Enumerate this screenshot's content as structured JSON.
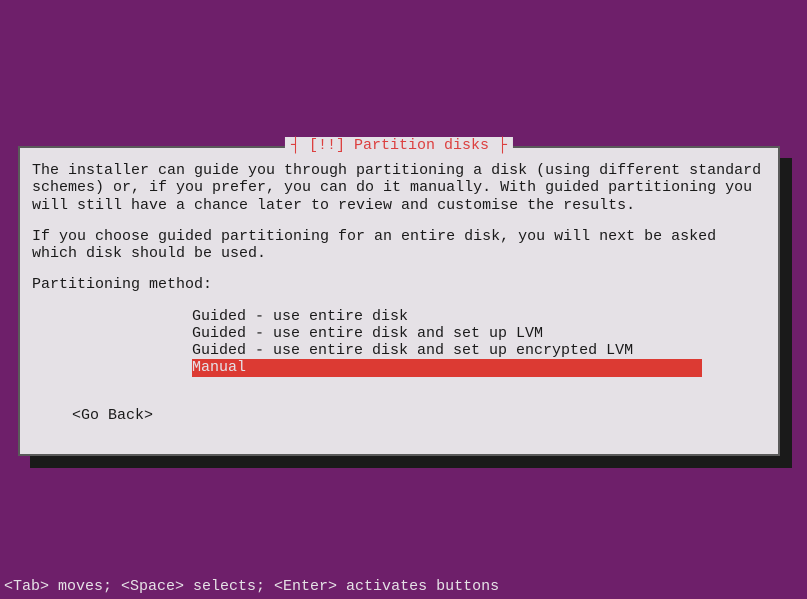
{
  "dialog": {
    "title_decoration_left": "┤ ",
    "title_priority": "[!!]",
    "title_text": " Partition disks",
    "title_decoration_right": " ├",
    "paragraph1": "The installer can guide you through partitioning a disk (using different standard schemes) or, if you prefer, you can do it manually. With guided partitioning you will still have a chance later to review and customise the results.",
    "paragraph2": "If you choose guided partitioning for an entire disk, you will next be asked which disk should be used.",
    "prompt": "Partitioning method:",
    "options": [
      "Guided - use entire disk",
      "Guided - use entire disk and set up LVM",
      "Guided - use entire disk and set up encrypted LVM",
      "Manual"
    ],
    "selected_index": 3,
    "go_back": "<Go Back>"
  },
  "footer_hint": "<Tab> moves; <Space> selects; <Enter> activates buttons"
}
